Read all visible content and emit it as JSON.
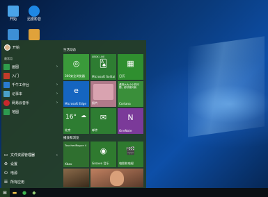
{
  "desktop": {
    "icons": [
      {
        "label": "开始",
        "icon": "computer-icon",
        "color": "#4aa3e8"
      },
      {
        "label": "迅雷影音",
        "icon": "media-player-icon",
        "color": "#1e88e5"
      },
      {
        "label": "",
        "icon": "network-icon",
        "color": "#3d8fd6"
      },
      {
        "label": "",
        "icon": "app-icon",
        "color": "#e0a23a"
      }
    ]
  },
  "start_menu": {
    "user": {
      "name": "开始"
    },
    "section_label": "最常用",
    "apps": [
      {
        "label": "画图",
        "icon": "paint-icon",
        "color": "#2f9c4b",
        "has_arrow": true
      },
      {
        "label": "入门",
        "icon": "tips-icon",
        "color": "#c13b2a",
        "has_arrow": false
      },
      {
        "label": "千牛工作台",
        "icon": "qianniu-icon",
        "color": "#2a7bd0",
        "has_arrow": true
      },
      {
        "label": "记事本",
        "icon": "notepad-icon",
        "color": "#4aa0c8",
        "has_arrow": true
      },
      {
        "label": "网易云音乐",
        "icon": "music-icon",
        "color": "#c8282d",
        "has_arrow": true
      },
      {
        "label": "地图",
        "icon": "maps-icon",
        "color": "#2d9a4f",
        "has_arrow": false
      }
    ],
    "system": [
      {
        "label": "文件资源管理器",
        "icon": "folder-icon",
        "has_arrow": true
      },
      {
        "label": "设置",
        "icon": "gear-icon",
        "has_arrow": false
      },
      {
        "label": "电源",
        "icon": "power-icon",
        "has_arrow": false
      },
      {
        "label": "所有应用",
        "icon": "list-icon",
        "has_arrow": false
      }
    ],
    "groups": {
      "life": "生活动态",
      "play": "播放和浏览"
    },
    "tiles": [
      {
        "id": "360",
        "label": "360安全浏览器",
        "icon": "globe-icon",
        "color": "#3a9a3a"
      },
      {
        "id": "solitaire",
        "label": "Microsoft Solitaire Collection",
        "top_text": "XBOX LIVE",
        "icon": "cards-icon",
        "color": "#2e7d32"
      },
      {
        "id": "calendar",
        "label": "日历",
        "icon": "calendar-icon",
        "color": "#2f8f2f"
      },
      {
        "id": "edge",
        "label": "Microsoft Edge",
        "icon": "edge-icon",
        "color": "#1565c0"
      },
      {
        "id": "photo",
        "label": "照片",
        "icon": "photo-icon",
        "color": "#7b5a3a"
      },
      {
        "id": "cortana",
        "label": "Cortana",
        "note": "遇到大大小小的问题，都尽管问我",
        "icon": "cortana-icon",
        "color": "#3a8f3a"
      },
      {
        "id": "weather",
        "label": "北京",
        "temp": "16°",
        "icon": "weather-icon",
        "color": "#2e7d32"
      },
      {
        "id": "mail",
        "label": "邮件",
        "icon": "mail-icon",
        "color": "#2e7d32"
      },
      {
        "id": "onenote",
        "label": "OneNote",
        "icon": "onenote-icon",
        "color": "#7b3a99"
      },
      {
        "id": "xbox",
        "label": "Xbox",
        "note": "TouchedRogue 4",
        "icon": "xbox-icon",
        "color": "#2f6f2f"
      },
      {
        "id": "groove",
        "label": "Groove 音乐",
        "icon": "groove-icon",
        "color": "#2f7a2f"
      },
      {
        "id": "movies",
        "label": "电影和电视",
        "icon": "film-icon",
        "color": "#2f7a2f"
      },
      {
        "id": "news1",
        "label": "",
        "icon": "news-photo-icon",
        "color": "#8a6a4a"
      },
      {
        "id": "news2",
        "label": "",
        "icon": "news-photo-icon",
        "color": "#a07050"
      }
    ]
  },
  "taskbar": {
    "buttons": [
      {
        "name": "start-button",
        "icon": "windows-icon"
      },
      {
        "name": "file-explorer-taskbar",
        "icon": "folder-icon"
      },
      {
        "name": "browser-taskbar",
        "icon": "globe-icon"
      },
      {
        "name": "app-taskbar",
        "icon": "app-icon"
      }
    ]
  }
}
